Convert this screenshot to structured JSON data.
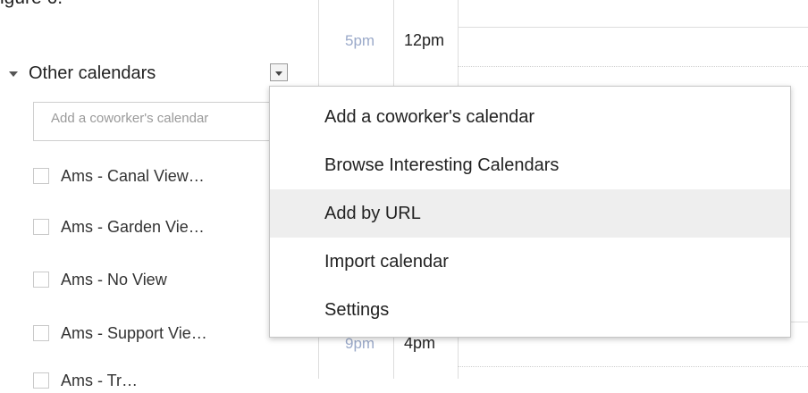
{
  "caption": "igure 6.",
  "time_rows": [
    {
      "tz1": "5pm",
      "tz2": "12pm"
    },
    {
      "tz1": "9pm",
      "tz2": "4pm"
    }
  ],
  "other_calendars": {
    "title": "Other calendars",
    "input_placeholder": "Add a coworker's calendar",
    "items": [
      {
        "label": "Ams - Canal View…"
      },
      {
        "label": "Ams - Garden Vie…"
      },
      {
        "label": "Ams - No View"
      },
      {
        "label": "Ams - Support Vie…"
      },
      {
        "label": "Ams - Tr…"
      }
    ]
  },
  "menu": {
    "items": [
      {
        "label": "Add a coworker's calendar"
      },
      {
        "label": "Browse Interesting Calendars"
      },
      {
        "label": "Add by URL",
        "highlighted": true
      },
      {
        "label": "Import calendar"
      },
      {
        "label": "Settings"
      }
    ]
  },
  "colors": {
    "menu_highlight": "#eeeeee",
    "secondary_timezone": "#9aa9c9",
    "grid_line": "#dddddd"
  }
}
